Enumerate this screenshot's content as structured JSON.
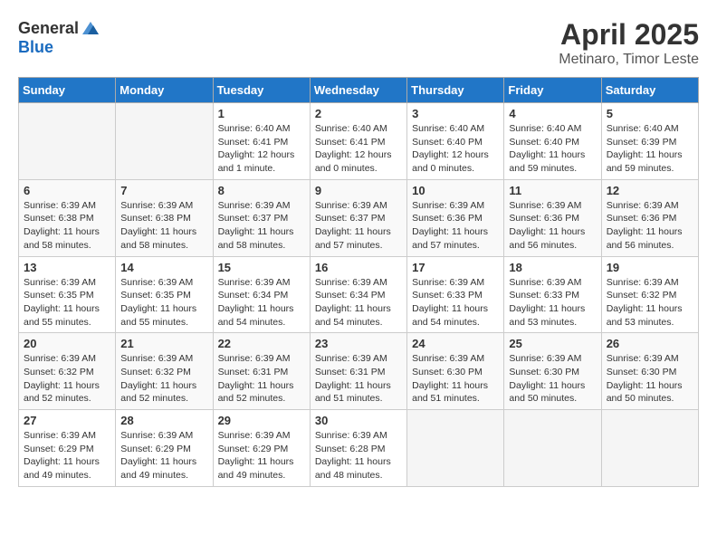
{
  "header": {
    "logo_general": "General",
    "logo_blue": "Blue",
    "month_title": "April 2025",
    "location": "Metinaro, Timor Leste"
  },
  "calendar": {
    "days_of_week": [
      "Sunday",
      "Monday",
      "Tuesday",
      "Wednesday",
      "Thursday",
      "Friday",
      "Saturday"
    ],
    "weeks": [
      [
        {
          "day": "",
          "empty": true
        },
        {
          "day": "",
          "empty": true
        },
        {
          "day": "1",
          "sunrise": "Sunrise: 6:40 AM",
          "sunset": "Sunset: 6:41 PM",
          "daylight": "Daylight: 12 hours and 1 minute."
        },
        {
          "day": "2",
          "sunrise": "Sunrise: 6:40 AM",
          "sunset": "Sunset: 6:41 PM",
          "daylight": "Daylight: 12 hours and 0 minutes."
        },
        {
          "day": "3",
          "sunrise": "Sunrise: 6:40 AM",
          "sunset": "Sunset: 6:40 PM",
          "daylight": "Daylight: 12 hours and 0 minutes."
        },
        {
          "day": "4",
          "sunrise": "Sunrise: 6:40 AM",
          "sunset": "Sunset: 6:40 PM",
          "daylight": "Daylight: 11 hours and 59 minutes."
        },
        {
          "day": "5",
          "sunrise": "Sunrise: 6:40 AM",
          "sunset": "Sunset: 6:39 PM",
          "daylight": "Daylight: 11 hours and 59 minutes."
        }
      ],
      [
        {
          "day": "6",
          "sunrise": "Sunrise: 6:39 AM",
          "sunset": "Sunset: 6:38 PM",
          "daylight": "Daylight: 11 hours and 58 minutes."
        },
        {
          "day": "7",
          "sunrise": "Sunrise: 6:39 AM",
          "sunset": "Sunset: 6:38 PM",
          "daylight": "Daylight: 11 hours and 58 minutes."
        },
        {
          "day": "8",
          "sunrise": "Sunrise: 6:39 AM",
          "sunset": "Sunset: 6:37 PM",
          "daylight": "Daylight: 11 hours and 58 minutes."
        },
        {
          "day": "9",
          "sunrise": "Sunrise: 6:39 AM",
          "sunset": "Sunset: 6:37 PM",
          "daylight": "Daylight: 11 hours and 57 minutes."
        },
        {
          "day": "10",
          "sunrise": "Sunrise: 6:39 AM",
          "sunset": "Sunset: 6:36 PM",
          "daylight": "Daylight: 11 hours and 57 minutes."
        },
        {
          "day": "11",
          "sunrise": "Sunrise: 6:39 AM",
          "sunset": "Sunset: 6:36 PM",
          "daylight": "Daylight: 11 hours and 56 minutes."
        },
        {
          "day": "12",
          "sunrise": "Sunrise: 6:39 AM",
          "sunset": "Sunset: 6:36 PM",
          "daylight": "Daylight: 11 hours and 56 minutes."
        }
      ],
      [
        {
          "day": "13",
          "sunrise": "Sunrise: 6:39 AM",
          "sunset": "Sunset: 6:35 PM",
          "daylight": "Daylight: 11 hours and 55 minutes."
        },
        {
          "day": "14",
          "sunrise": "Sunrise: 6:39 AM",
          "sunset": "Sunset: 6:35 PM",
          "daylight": "Daylight: 11 hours and 55 minutes."
        },
        {
          "day": "15",
          "sunrise": "Sunrise: 6:39 AM",
          "sunset": "Sunset: 6:34 PM",
          "daylight": "Daylight: 11 hours and 54 minutes."
        },
        {
          "day": "16",
          "sunrise": "Sunrise: 6:39 AM",
          "sunset": "Sunset: 6:34 PM",
          "daylight": "Daylight: 11 hours and 54 minutes."
        },
        {
          "day": "17",
          "sunrise": "Sunrise: 6:39 AM",
          "sunset": "Sunset: 6:33 PM",
          "daylight": "Daylight: 11 hours and 54 minutes."
        },
        {
          "day": "18",
          "sunrise": "Sunrise: 6:39 AM",
          "sunset": "Sunset: 6:33 PM",
          "daylight": "Daylight: 11 hours and 53 minutes."
        },
        {
          "day": "19",
          "sunrise": "Sunrise: 6:39 AM",
          "sunset": "Sunset: 6:32 PM",
          "daylight": "Daylight: 11 hours and 53 minutes."
        }
      ],
      [
        {
          "day": "20",
          "sunrise": "Sunrise: 6:39 AM",
          "sunset": "Sunset: 6:32 PM",
          "daylight": "Daylight: 11 hours and 52 minutes."
        },
        {
          "day": "21",
          "sunrise": "Sunrise: 6:39 AM",
          "sunset": "Sunset: 6:32 PM",
          "daylight": "Daylight: 11 hours and 52 minutes."
        },
        {
          "day": "22",
          "sunrise": "Sunrise: 6:39 AM",
          "sunset": "Sunset: 6:31 PM",
          "daylight": "Daylight: 11 hours and 52 minutes."
        },
        {
          "day": "23",
          "sunrise": "Sunrise: 6:39 AM",
          "sunset": "Sunset: 6:31 PM",
          "daylight": "Daylight: 11 hours and 51 minutes."
        },
        {
          "day": "24",
          "sunrise": "Sunrise: 6:39 AM",
          "sunset": "Sunset: 6:30 PM",
          "daylight": "Daylight: 11 hours and 51 minutes."
        },
        {
          "day": "25",
          "sunrise": "Sunrise: 6:39 AM",
          "sunset": "Sunset: 6:30 PM",
          "daylight": "Daylight: 11 hours and 50 minutes."
        },
        {
          "day": "26",
          "sunrise": "Sunrise: 6:39 AM",
          "sunset": "Sunset: 6:30 PM",
          "daylight": "Daylight: 11 hours and 50 minutes."
        }
      ],
      [
        {
          "day": "27",
          "sunrise": "Sunrise: 6:39 AM",
          "sunset": "Sunset: 6:29 PM",
          "daylight": "Daylight: 11 hours and 49 minutes."
        },
        {
          "day": "28",
          "sunrise": "Sunrise: 6:39 AM",
          "sunset": "Sunset: 6:29 PM",
          "daylight": "Daylight: 11 hours and 49 minutes."
        },
        {
          "day": "29",
          "sunrise": "Sunrise: 6:39 AM",
          "sunset": "Sunset: 6:29 PM",
          "daylight": "Daylight: 11 hours and 49 minutes."
        },
        {
          "day": "30",
          "sunrise": "Sunrise: 6:39 AM",
          "sunset": "Sunset: 6:28 PM",
          "daylight": "Daylight: 11 hours and 48 minutes."
        },
        {
          "day": "",
          "empty": true
        },
        {
          "day": "",
          "empty": true
        },
        {
          "day": "",
          "empty": true
        }
      ]
    ]
  }
}
